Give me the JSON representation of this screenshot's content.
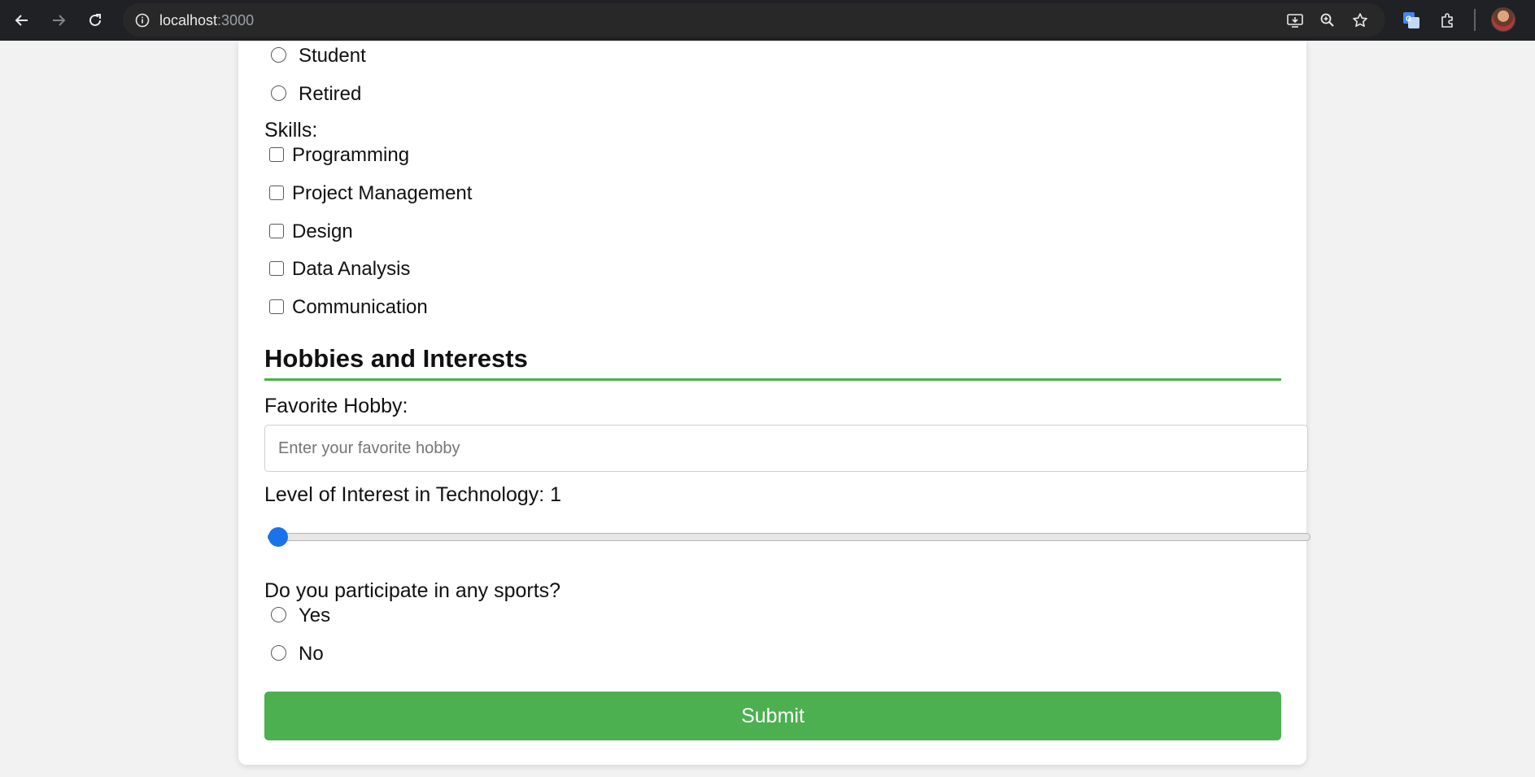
{
  "browser": {
    "url_host": "localhost",
    "url_port": ":3000"
  },
  "form": {
    "occupation_options": [
      {
        "label": "Student",
        "checked": false
      },
      {
        "label": "Retired",
        "checked": false
      }
    ],
    "skills": {
      "label": "Skills:",
      "options": [
        {
          "label": "Programming",
          "checked": false
        },
        {
          "label": "Project Management",
          "checked": false
        },
        {
          "label": "Design",
          "checked": false
        },
        {
          "label": "Data Analysis",
          "checked": false
        },
        {
          "label": "Communication",
          "checked": false
        }
      ]
    },
    "hobbies_section": {
      "title": "Hobbies and Interests",
      "favorite_hobby_label": "Favorite Hobby:",
      "favorite_hobby_placeholder": "Enter your favorite hobby",
      "favorite_hobby_value": "",
      "interest_label": "Level of Interest in Technology: 1",
      "interest_value": 1,
      "interest_min": 1,
      "interest_max": 10,
      "sports_question": "Do you participate in any sports?",
      "sports_options": [
        {
          "label": "Yes",
          "checked": false
        },
        {
          "label": "No",
          "checked": false
        }
      ]
    },
    "submit_label": "Submit"
  },
  "colors": {
    "accent_green": "#4caf50",
    "slider_blue": "#1a73e8",
    "chrome_dark": "#202124"
  }
}
